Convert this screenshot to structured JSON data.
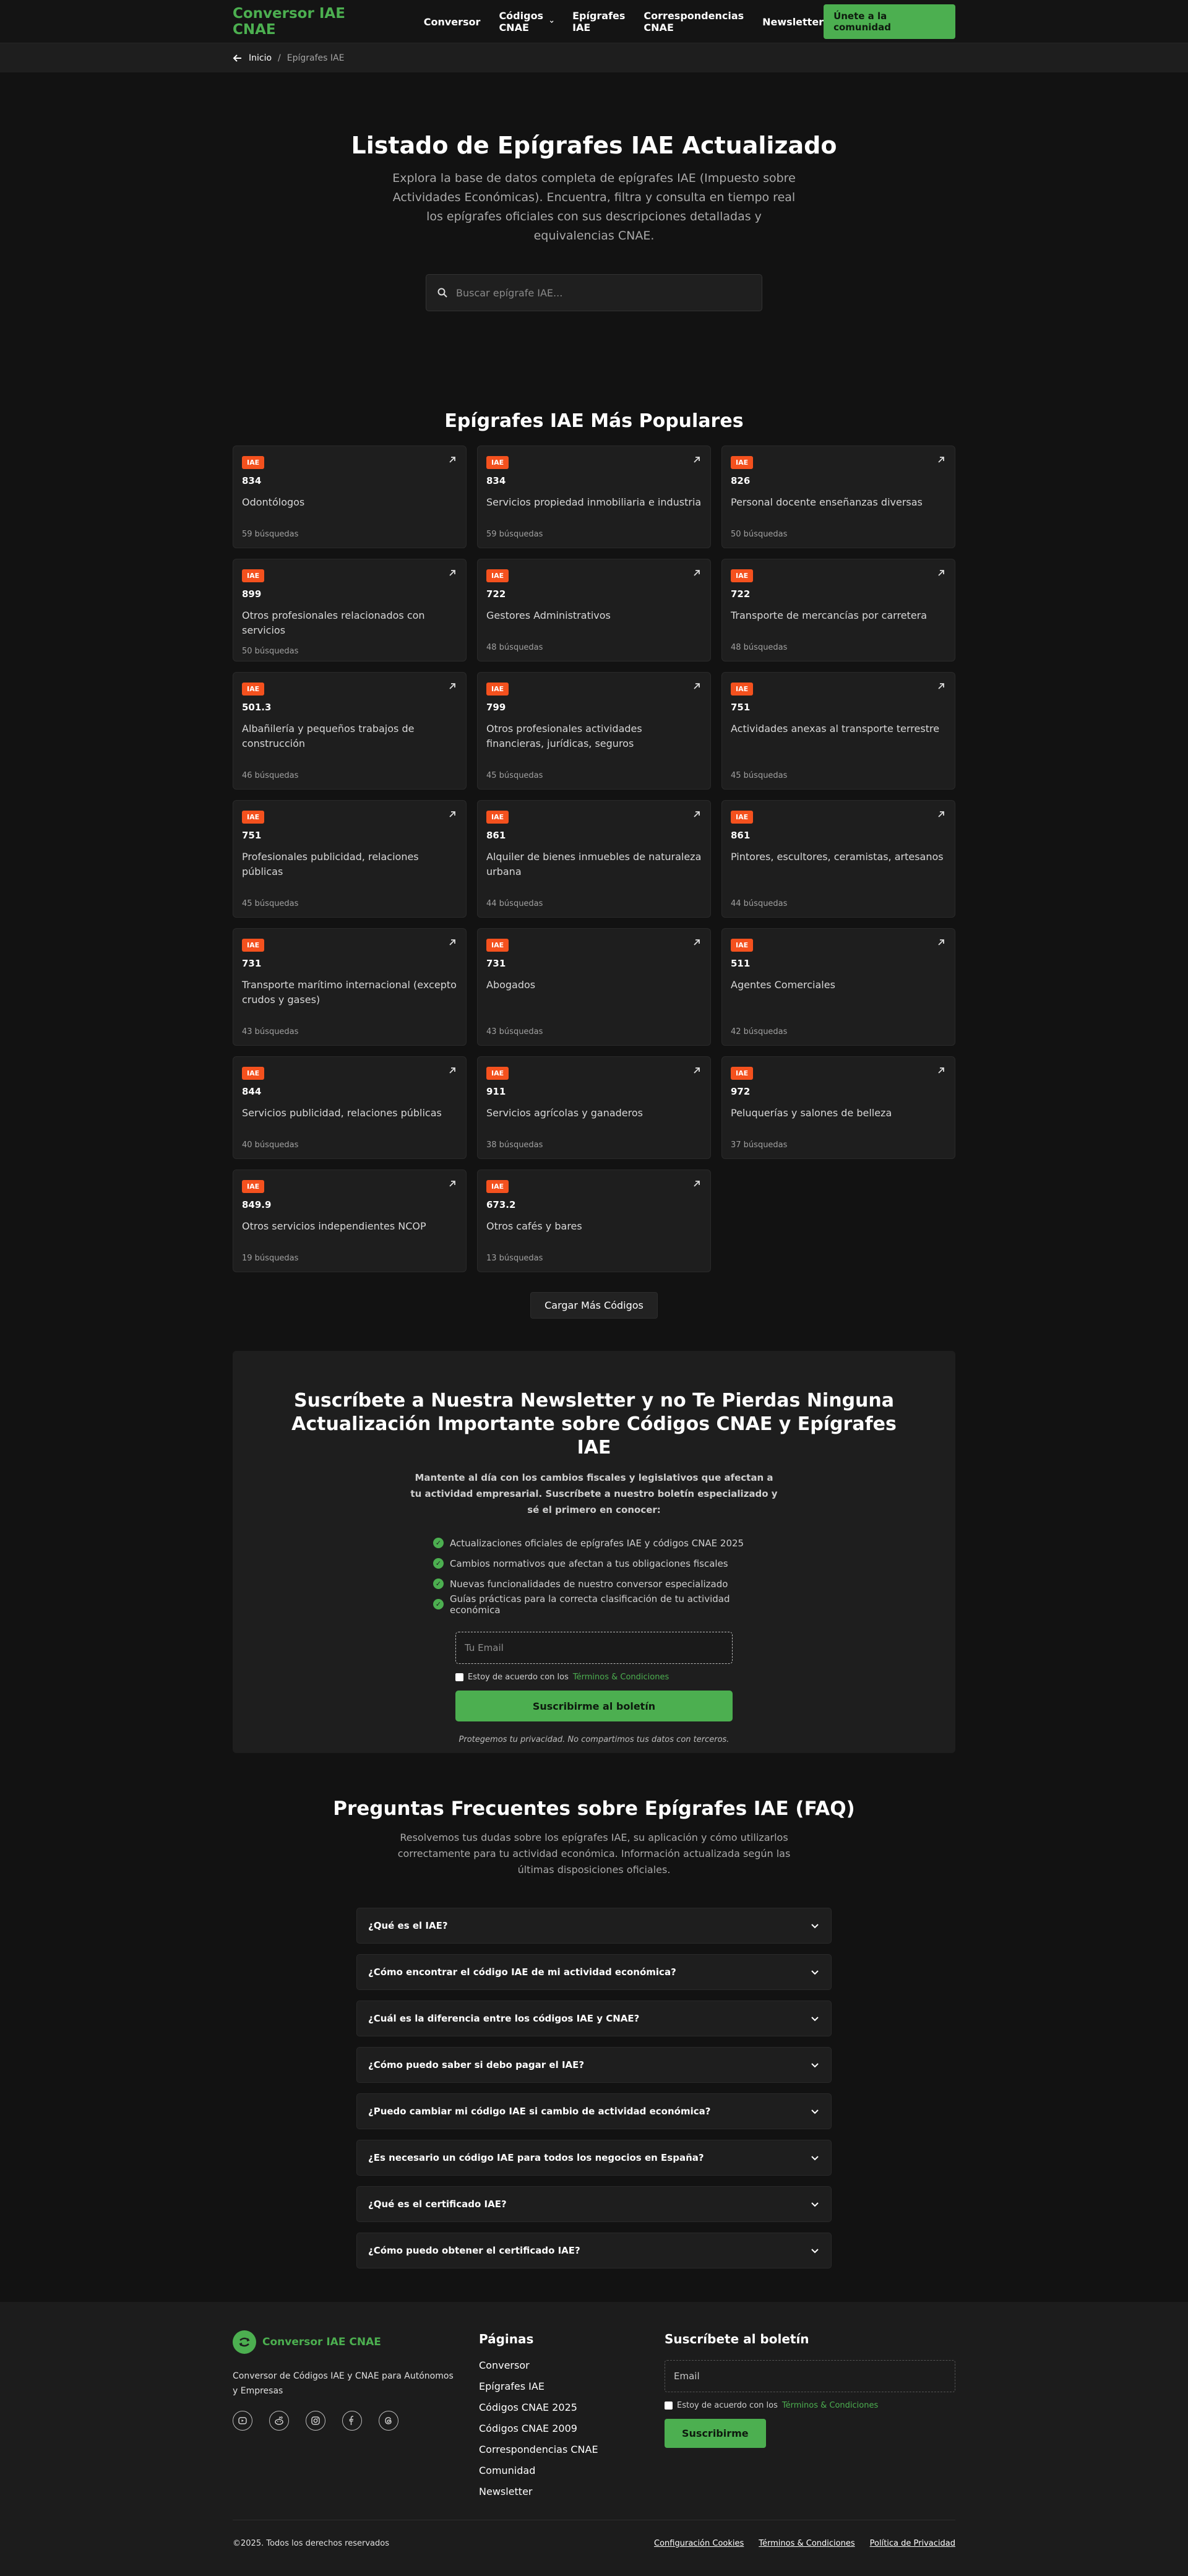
{
  "header": {
    "brand": "Conversor IAE CNAE",
    "nav": [
      "Conversor",
      "Códigos CNAE",
      "Epígrafes IAE",
      "Correspondencias CNAE",
      "Newsletter"
    ],
    "cta": "Únete a la comunidad"
  },
  "breadcrumb": {
    "home": "Inicio",
    "separator": "/",
    "current": "Epígrafes IAE"
  },
  "hero": {
    "title": "Listado de Epígrafes IAE Actualizado",
    "subtitle": "Explora la base de datos completa de epígrafes IAE (Impuesto sobre Actividades Económicas). Encuentra, filtra y consulta en tiempo real los epígrafes oficiales con sus descripciones detalladas y equivalencias CNAE.",
    "search_placeholder": "Buscar epígrafe IAE..."
  },
  "popular": {
    "title": "Epígrafes IAE Más Populares",
    "badge": "IAE",
    "cards": [
      {
        "code": "834",
        "desc": "Odontólogos",
        "count": "59 búsquedas"
      },
      {
        "code": "834",
        "desc": "Servicios propiedad inmobiliaria e industria",
        "count": "59 búsquedas"
      },
      {
        "code": "826",
        "desc": "Personal docente enseñanzas diversas",
        "count": "50 búsquedas"
      },
      {
        "code": "899",
        "desc": "Otros profesionales relacionados con servicios",
        "count": "50 búsquedas"
      },
      {
        "code": "722",
        "desc": "Gestores Administrativos",
        "count": "48 búsquedas"
      },
      {
        "code": "722",
        "desc": "Transporte de mercancías por carretera",
        "count": "48 búsquedas"
      },
      {
        "code": "501.3",
        "desc": "Albañilería y pequeños trabajos de construcción",
        "count": "46 búsquedas"
      },
      {
        "code": "799",
        "desc": "Otros profesionales actividades financieras, jurídicas, seguros",
        "count": "45 búsquedas"
      },
      {
        "code": "751",
        "desc": "Actividades anexas al transporte terrestre",
        "count": "45 búsquedas"
      },
      {
        "code": "751",
        "desc": "Profesionales publicidad, relaciones públicas",
        "count": "45 búsquedas"
      },
      {
        "code": "861",
        "desc": "Alquiler de bienes inmuebles de naturaleza urbana",
        "count": "44 búsquedas"
      },
      {
        "code": "861",
        "desc": "Pintores, escultores, ceramistas, artesanos",
        "count": "44 búsquedas"
      },
      {
        "code": "731",
        "desc": "Transporte marítimo internacional (excepto crudos y gases)",
        "count": "43 búsquedas"
      },
      {
        "code": "731",
        "desc": "Abogados",
        "count": "43 búsquedas"
      },
      {
        "code": "511",
        "desc": "Agentes Comerciales",
        "count": "42 búsquedas"
      },
      {
        "code": "844",
        "desc": "Servicios publicidad, relaciones públicas",
        "count": "40 búsquedas"
      },
      {
        "code": "911",
        "desc": "Servicios agrícolas y ganaderos",
        "count": "38 búsquedas"
      },
      {
        "code": "972",
        "desc": "Peluquerías y salones de belleza",
        "count": "37 búsquedas"
      },
      {
        "code": "849.9",
        "desc": "Otros servicios independientes NCOP",
        "count": "19 búsquedas"
      },
      {
        "code": "673.2",
        "desc": "Otros cafés y bares",
        "count": "13 búsquedas"
      }
    ],
    "load_more": "Cargar Más Códigos"
  },
  "newsletter": {
    "title": "Suscríbete a Nuestra Newsletter y no Te Pierdas Ninguna Actualización Importante sobre Códigos CNAE y Epígrafes IAE",
    "text": "Mantente al día con los cambios fiscales y legislativos que afectan a tu actividad empresarial. Suscríbete a nuestro boletín especializado y sé el primero en conocer:",
    "benefits": [
      "Actualizaciones oficiales de epígrafes IAE y códigos CNAE 2025",
      "Cambios normativos que afectan a tus obligaciones fiscales",
      "Nuevas funcionalidades de nuestro conversor especializado",
      "Guías prácticas para la correcta clasificación de tu actividad económica"
    ],
    "email_placeholder": "Tu Email",
    "agree_text": "Estoy de acuerdo con los",
    "agree_link": "Términos & Condiciones",
    "submit": "Suscribirme al boletín",
    "privacy": "Protegemos tu privacidad. No compartimos tus datos con terceros."
  },
  "faq": {
    "title": "Preguntas Frecuentes sobre Epígrafes IAE (FAQ)",
    "intro": "Resolvemos tus dudas sobre los epígrafes IAE, su aplicación y cómo utilizarlos correctamente para tu actividad económica. Información actualizada según las últimas disposiciones oficiales.",
    "items": [
      "¿Qué es el IAE?",
      "¿Cómo encontrar el código IAE de mi actividad económica?",
      "¿Cuál es la diferencia entre los códigos IAE y CNAE?",
      "¿Cómo puedo saber si debo pagar el IAE?",
      "¿Puedo cambiar mi código IAE si cambio de actividad económica?",
      "¿Es necesario un código IAE para todos los negocios en España?",
      "¿Qué es el certificado IAE?",
      "¿Cómo puedo obtener el certificado IAE?"
    ]
  },
  "footer": {
    "brand": "Conversor IAE CNAE",
    "tagline": "Conversor de Códigos IAE y CNAE para Autónomos y Empresas",
    "socials": [
      "youtube-icon",
      "reddit-icon",
      "instagram-icon",
      "facebook-icon",
      "threads-icon"
    ],
    "pages_title": "Páginas",
    "pages": [
      "Conversor",
      "Epígrafes IAE",
      "Códigos CNAE 2025",
      "Códigos CNAE 2009",
      "Correspondencias CNAE",
      "Comunidad",
      "Newsletter"
    ],
    "newsletter_title": "Suscríbete al boletín",
    "email_placeholder": "Email",
    "agree_text": "Estoy de acuerdo con los",
    "agree_link": "Términos & Condiciones",
    "submit": "Suscribirme",
    "copyright": "©2025. Todos los derechos reservados",
    "legal": [
      "Configuración Cookies",
      "Términos & Condiciones",
      "Política de Privacidad"
    ]
  },
  "colors": {
    "accent": "#4caf50",
    "badge": "#f4511e",
    "background": "#121212",
    "card": "#1e1e1e"
  }
}
